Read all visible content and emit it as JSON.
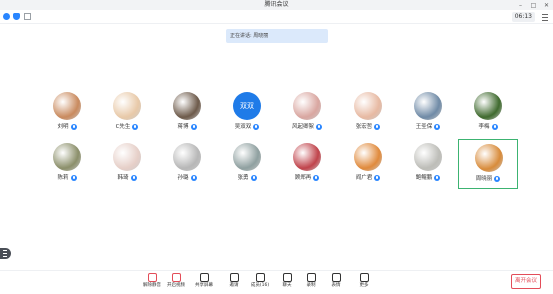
{
  "window": {
    "title": "腾讯会议"
  },
  "toolbar": {
    "timer": "06:13"
  },
  "banner": {
    "speaking_text": "正在讲话: 周晓丽"
  },
  "participants": [
    {
      "name": "刘明",
      "avatar": "photo-sunset",
      "color": "#c98a5e"
    },
    {
      "name": "C先生",
      "avatar": "photo-light",
      "color": "#e8c9a8"
    },
    {
      "name": "蒋博",
      "avatar": "photo-person",
      "color": "#6d5a4a"
    },
    {
      "name": "吴双双",
      "avatar": "text",
      "text": "双双",
      "color": "#1f7be8"
    },
    {
      "name": "风起卿絮",
      "avatar": "photo-flowers",
      "color": "#d9a6a0"
    },
    {
      "name": "张宏哲",
      "avatar": "photo-sky",
      "color": "#e7b9a2"
    },
    {
      "name": "王圣保",
      "avatar": "photo-horizon",
      "color": "#6f8aa6"
    },
    {
      "name": "李梅",
      "avatar": "photo-tree",
      "color": "#3f6a2e"
    },
    {
      "name": "陈莉",
      "avatar": "photo-dog",
      "color": "#8b8f6a"
    },
    {
      "name": "韩琦",
      "avatar": "photo-portrait",
      "color": "#e6cfc8"
    },
    {
      "name": "孙璐",
      "avatar": "photo-sketch",
      "color": "#b7b7b7"
    },
    {
      "name": "张勇",
      "avatar": "photo-shell",
      "color": "#8fa0a0"
    },
    {
      "name": "顾郑再",
      "avatar": "photo-tile",
      "color": "#c0434b"
    },
    {
      "name": "阎广君",
      "avatar": "photo-fruit",
      "color": "#e08a3c"
    },
    {
      "name": "鲍鲲鹏",
      "avatar": "photo-stone",
      "color": "#bdbdb8"
    },
    {
      "name": "周晓丽",
      "avatar": "photo-puppy",
      "color": "#d88b3a",
      "active": true
    }
  ],
  "controls": [
    {
      "label": "解除静音",
      "icon": "mic-muted-icon",
      "color": "#e34d59"
    },
    {
      "label": "开启视频",
      "icon": "camera-off-icon",
      "color": "#e34d59"
    },
    {
      "label": "共享屏幕",
      "icon": "screen-share-icon",
      "color": "#333333"
    },
    {
      "label": "邀请",
      "icon": "invite-icon",
      "color": "#333333"
    },
    {
      "label": "成员(16)",
      "icon": "members-icon",
      "color": "#333333"
    },
    {
      "label": "聊天",
      "icon": "chat-icon",
      "color": "#333333"
    },
    {
      "label": "录制",
      "icon": "record-icon",
      "color": "#333333"
    },
    {
      "label": "表情",
      "icon": "emoji-icon",
      "color": "#333333"
    },
    {
      "label": "更多",
      "icon": "more-icon",
      "color": "#333333"
    }
  ],
  "leave": {
    "label": "离开会议"
  }
}
